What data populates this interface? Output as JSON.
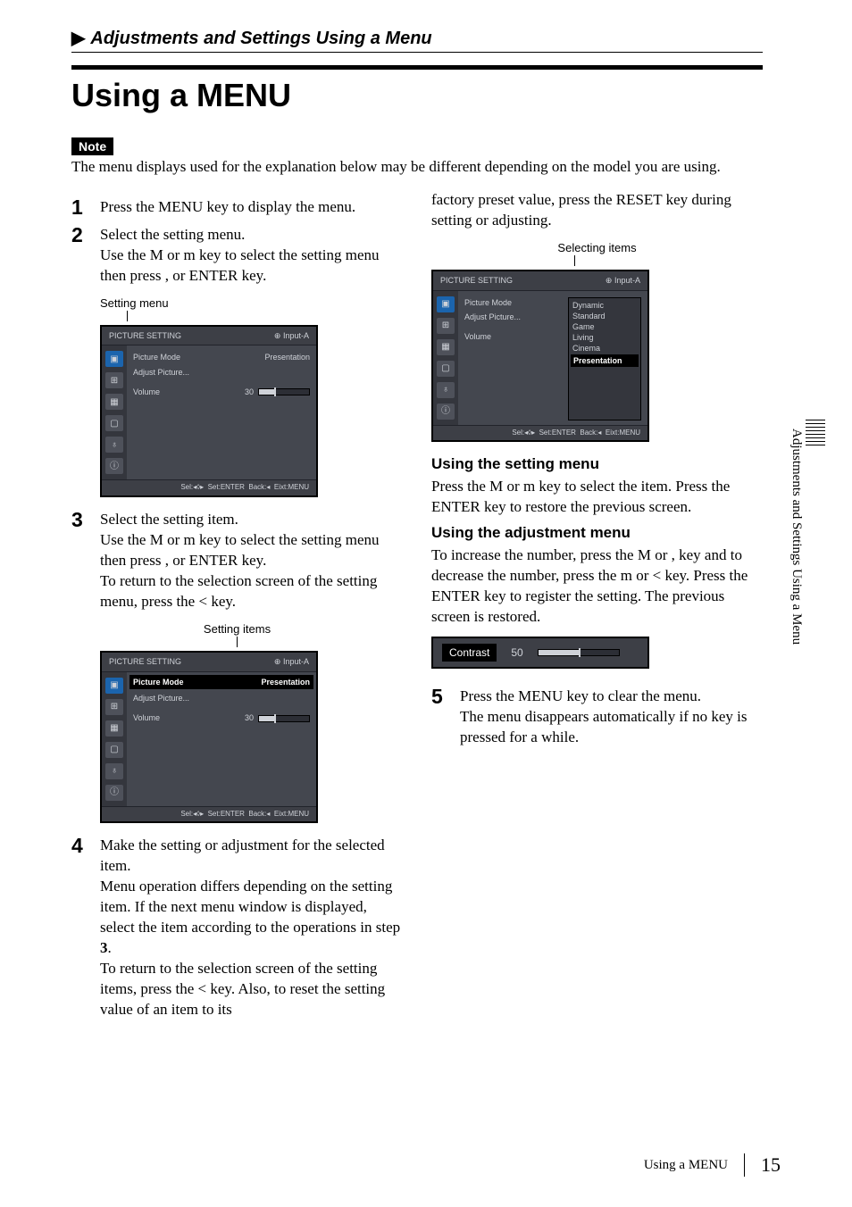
{
  "section_header": "Adjustments and Settings Using a Menu",
  "page_title": "Using a MENU",
  "note_label": "Note",
  "note_text": "The menu displays used for the explanation below may be different depending on the model you are using.",
  "steps": {
    "s1": {
      "num": "1",
      "lead": "Press the MENU key to display the menu."
    },
    "s2": {
      "num": "2",
      "lead": "Select the setting menu.",
      "body": "Use the M or m key to select the setting menu then press , or ENTER key."
    },
    "s3": {
      "num": "3",
      "lead": "Select the setting item.",
      "body1": "Use the M or m key to select the setting menu then press , or ENTER key.",
      "body2": "To return to the selection screen of the setting menu, press the < key."
    },
    "s4": {
      "num": "4",
      "lead": "Make the setting or adjustment for the selected item.",
      "body1": "Menu operation differs depending on the setting item. If the next menu window is displayed, select the item according to the operations in step ",
      "bold": "3",
      "body1b": ".",
      "body2": "To return to the selection screen of the setting items, press the < key. Also, to reset the setting value of an item to its"
    },
    "s4_cont": "factory preset value, press the RESET key during setting or adjusting.",
    "s5": {
      "num": "5",
      "lead": "Press the MENU key to clear the menu.",
      "body": "The menu disappears automatically if no key is pressed for a while."
    }
  },
  "captions": {
    "setting_menu": "Setting menu",
    "setting_items": "Setting items",
    "selecting_items": "Selecting items"
  },
  "osd": {
    "title": "PICTURE SETTING",
    "input": "Input-A",
    "rows": {
      "picture_mode": "Picture Mode",
      "picture_mode_val": "Presentation",
      "adjust_picture": "Adjust Picture...",
      "volume": "Volume",
      "volume_val": "30"
    },
    "options": [
      "Dynamic",
      "Standard",
      "Game",
      "Living",
      "Cinema",
      "Presentation"
    ],
    "footer_sel": "Sel:",
    "footer_set": "Set:",
    "footer_back": "Back:",
    "footer_exit": "Eixt:",
    "footer_enter": "ENTER",
    "footer_menu": "MENU"
  },
  "subheads": {
    "using_setting_menu": "Using the setting menu",
    "using_setting_menu_body": "Press the M or m key to select the item. Press the ENTER key to restore the previous screen.",
    "using_adjust_menu": "Using the adjustment menu",
    "using_adjust_menu_body": "To increase the number, press the M or , key and to decrease the number, press the m or < key. Press the ENTER key to register the setting. The previous screen is restored."
  },
  "contrast": {
    "label": "Contrast",
    "value": "50"
  },
  "side_tab": "Adjustments and Settings Using a Menu",
  "footer": {
    "title": "Using a MENU",
    "page": "15"
  }
}
